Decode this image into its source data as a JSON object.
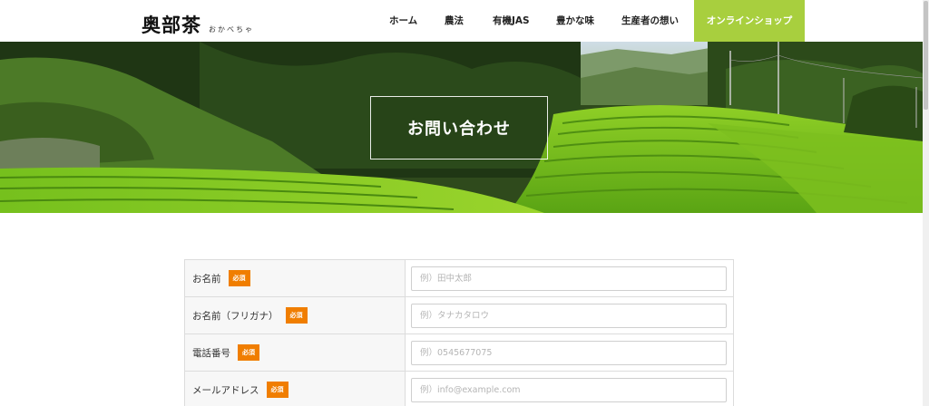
{
  "header": {
    "logo_main": "奥部茶",
    "logo_sub": "おかべちゃ",
    "nav": [
      {
        "label": "ホーム"
      },
      {
        "label": "農法"
      },
      {
        "label": "有機JAS"
      },
      {
        "label": "豊かな味"
      },
      {
        "label": "生産者の想い"
      }
    ],
    "shop_label": "オンラインショップ",
    "shop_color": "#a8cf3e"
  },
  "hero": {
    "title": "お問い合わせ"
  },
  "form": {
    "required_label": "必須",
    "required_color": "#f07e00",
    "fields": [
      {
        "label": "お名前",
        "placeholder": "例）田中太郎"
      },
      {
        "label": "お名前（フリガナ）",
        "placeholder": "例）タナカタロウ"
      },
      {
        "label": "電話番号",
        "placeholder": "例）0545677075"
      },
      {
        "label": "メールアドレス",
        "placeholder": "例）info@example.com"
      }
    ]
  }
}
